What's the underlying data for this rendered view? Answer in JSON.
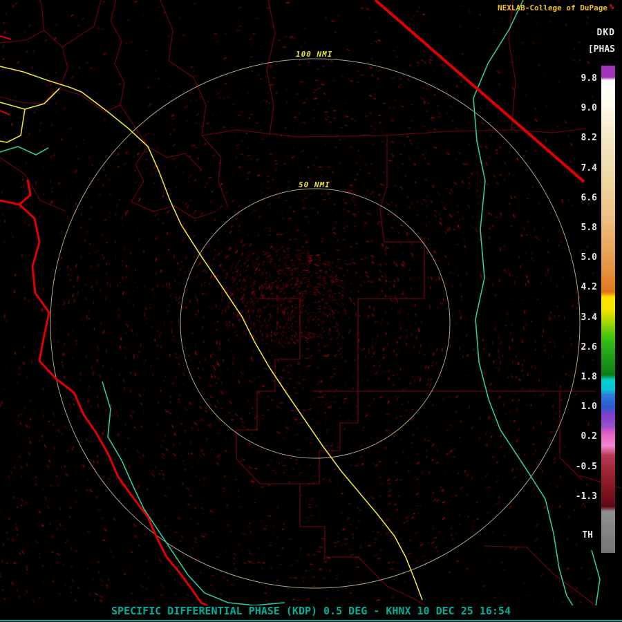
{
  "header": {
    "brand": "NEXLAB-College of DuPage",
    "brand_mark": "%"
  },
  "colorbar": {
    "product_code": "DKD",
    "units_label": "[PHAS",
    "threshold_label": "TH",
    "ticks": [
      "9.8",
      "9.0",
      "8.2",
      "7.4",
      "6.6",
      "5.8",
      "5.0",
      "4.2",
      "3.4",
      "2.6",
      "1.8",
      "1.0",
      "0.2",
      "-0.5",
      "-1.3"
    ]
  },
  "rings": {
    "outer_label": "100 NMI",
    "inner_label": "50 NMI"
  },
  "footer": {
    "status_text": "SPECIFIC DIFFERENTIAL PHASE (KDP) 0.5 DEG - KHNX 10 DEC 25 16:54"
  },
  "colors": {
    "accent_yellow": "#ede23c",
    "ring": "#ccc49a",
    "teal": "#2fc89b",
    "red": "#e00000",
    "county": "#7c0310",
    "footer": "#00af9b",
    "brand": "#f0c020",
    "tick": "#e6e6e6"
  }
}
